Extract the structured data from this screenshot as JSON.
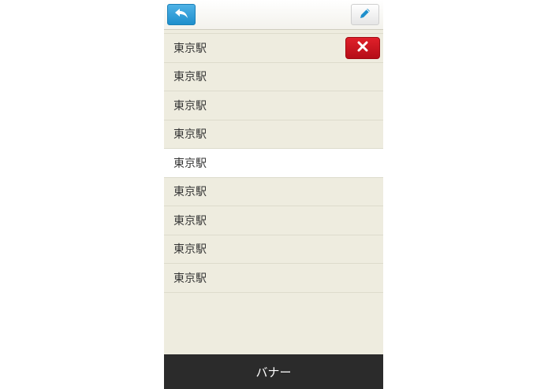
{
  "header": {
    "back_icon": "reply-arrow-icon",
    "edit_icon": "pencil-icon"
  },
  "stations": [
    {
      "label": "東京駅",
      "state": "delete-visible"
    },
    {
      "label": "東京駅",
      "state": "normal"
    },
    {
      "label": "東京駅",
      "state": "normal"
    },
    {
      "label": "東京駅",
      "state": "normal"
    },
    {
      "label": "東京駅",
      "state": "selected"
    },
    {
      "label": "東京駅",
      "state": "normal"
    },
    {
      "label": "東京駅",
      "state": "normal"
    },
    {
      "label": "東京駅",
      "state": "normal"
    },
    {
      "label": "東京駅",
      "state": "normal"
    }
  ],
  "delete_icon": "close-x-icon",
  "banner": {
    "label": "バナー"
  },
  "colors": {
    "background": "#eeecdf",
    "accent_blue": "#1e8fcc",
    "delete_red": "#c8141e",
    "banner_bg": "#2b2b2b",
    "selected_row": "#ffffff"
  }
}
